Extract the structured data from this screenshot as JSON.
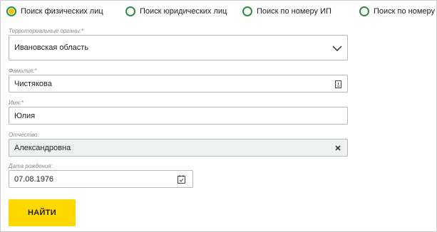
{
  "search_tabs": [
    {
      "label": "Поиск физических лиц",
      "selected": true
    },
    {
      "label": "Поиск юридических лиц",
      "selected": false
    },
    {
      "label": "Поиск по номеру ИП",
      "selected": false
    },
    {
      "label": "Поиск по номеру ИД",
      "selected": false
    }
  ],
  "form": {
    "region": {
      "label": "Территориальные органы:*",
      "value": "Ивановская область",
      "icon": "chevron-down-icon"
    },
    "lastname": {
      "label": "Фамилия:*",
      "value": "Чистякова",
      "icon": "keyboard-icon"
    },
    "firstname": {
      "label": "Имя:*",
      "value": "Юлия"
    },
    "patronymic": {
      "label": "Отчество:",
      "value": "Александровна",
      "icon": "clear-icon",
      "background": "#eef3f2"
    },
    "birthdate": {
      "label": "Дата рождения:",
      "value": "07.08.1976",
      "icon": "calendar-icon"
    }
  },
  "submit": {
    "label": "НАЙТИ",
    "color": "#ffd800"
  },
  "colors": {
    "radio_ring": "#2e8b3f",
    "radio_dot": "#f2c200"
  }
}
